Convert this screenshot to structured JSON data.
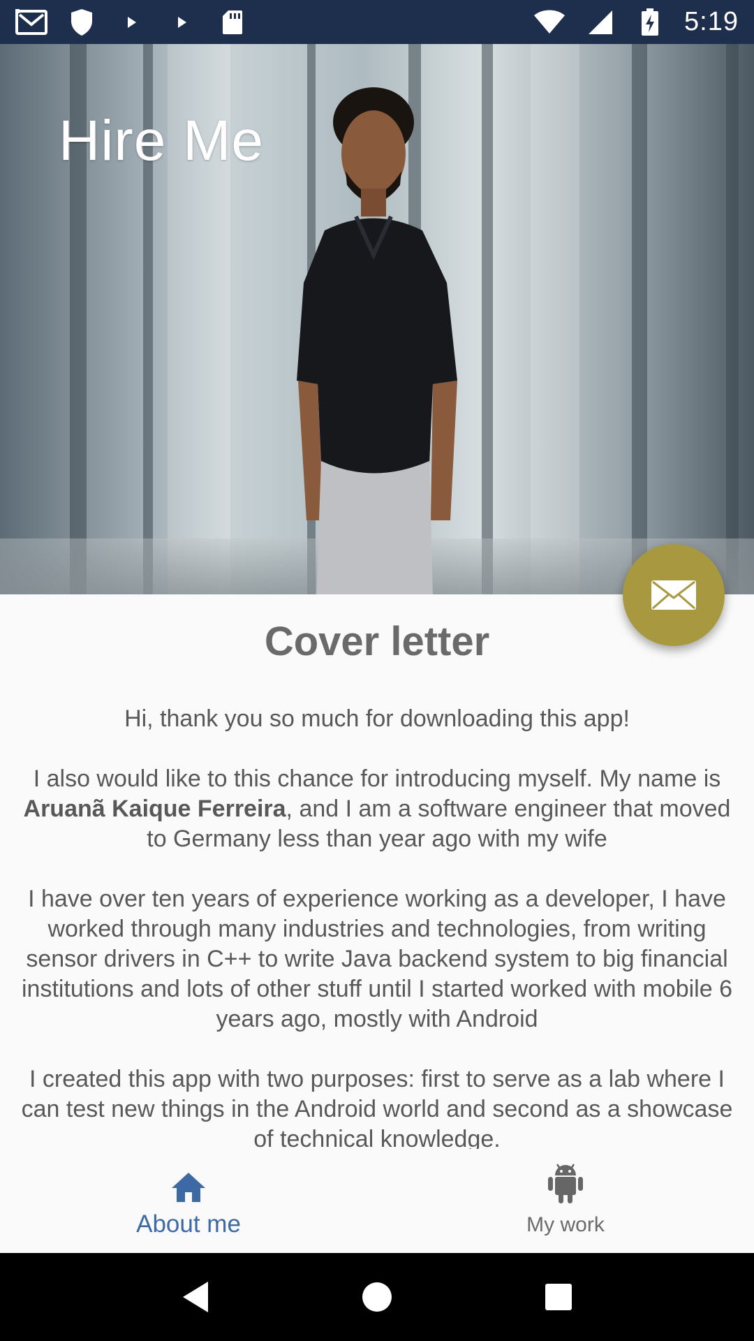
{
  "status_bar": {
    "time": "5:19",
    "icons_left": [
      "gmail-icon",
      "shield-icon",
      "play-icon",
      "play-icon",
      "sd-card-icon"
    ],
    "icons_right": [
      "wifi-icon",
      "signal-icon",
      "battery-charging-icon"
    ]
  },
  "hero": {
    "title": "Hire Me"
  },
  "content": {
    "title": "Cover letter",
    "paragraph1": "Hi, thank you so much for downloading this app!",
    "paragraph2_before": "I also would like to this chance for introducing myself. My name is ",
    "paragraph2_name": "Aruanã Kaique Ferreira",
    "paragraph2_after": ", and I am a software engineer that moved to Germany less than year ago with my wife",
    "paragraph3": "I have over ten years of experience working as a developer, I have worked through many industries and technologies, from writing sensor drivers in C++ to write Java backend system to big financial institutions and lots of other stuff until I started worked with mobile 6 years ago, mostly with Android",
    "paragraph4": "I created this app with two purposes: first to serve as a lab where I can test new things in the Android world and second as a showcase of technical knowledge."
  },
  "fab": {
    "icon": "mail-icon",
    "color": "#a89940"
  },
  "bottom_nav": {
    "items": [
      {
        "label": "About me",
        "icon": "home-icon",
        "active": true
      },
      {
        "label": "My work",
        "icon": "android-icon",
        "active": false
      }
    ],
    "active_color": "#3d69a5"
  },
  "system_nav": [
    "back-icon",
    "home-circle-icon",
    "recents-icon"
  ]
}
